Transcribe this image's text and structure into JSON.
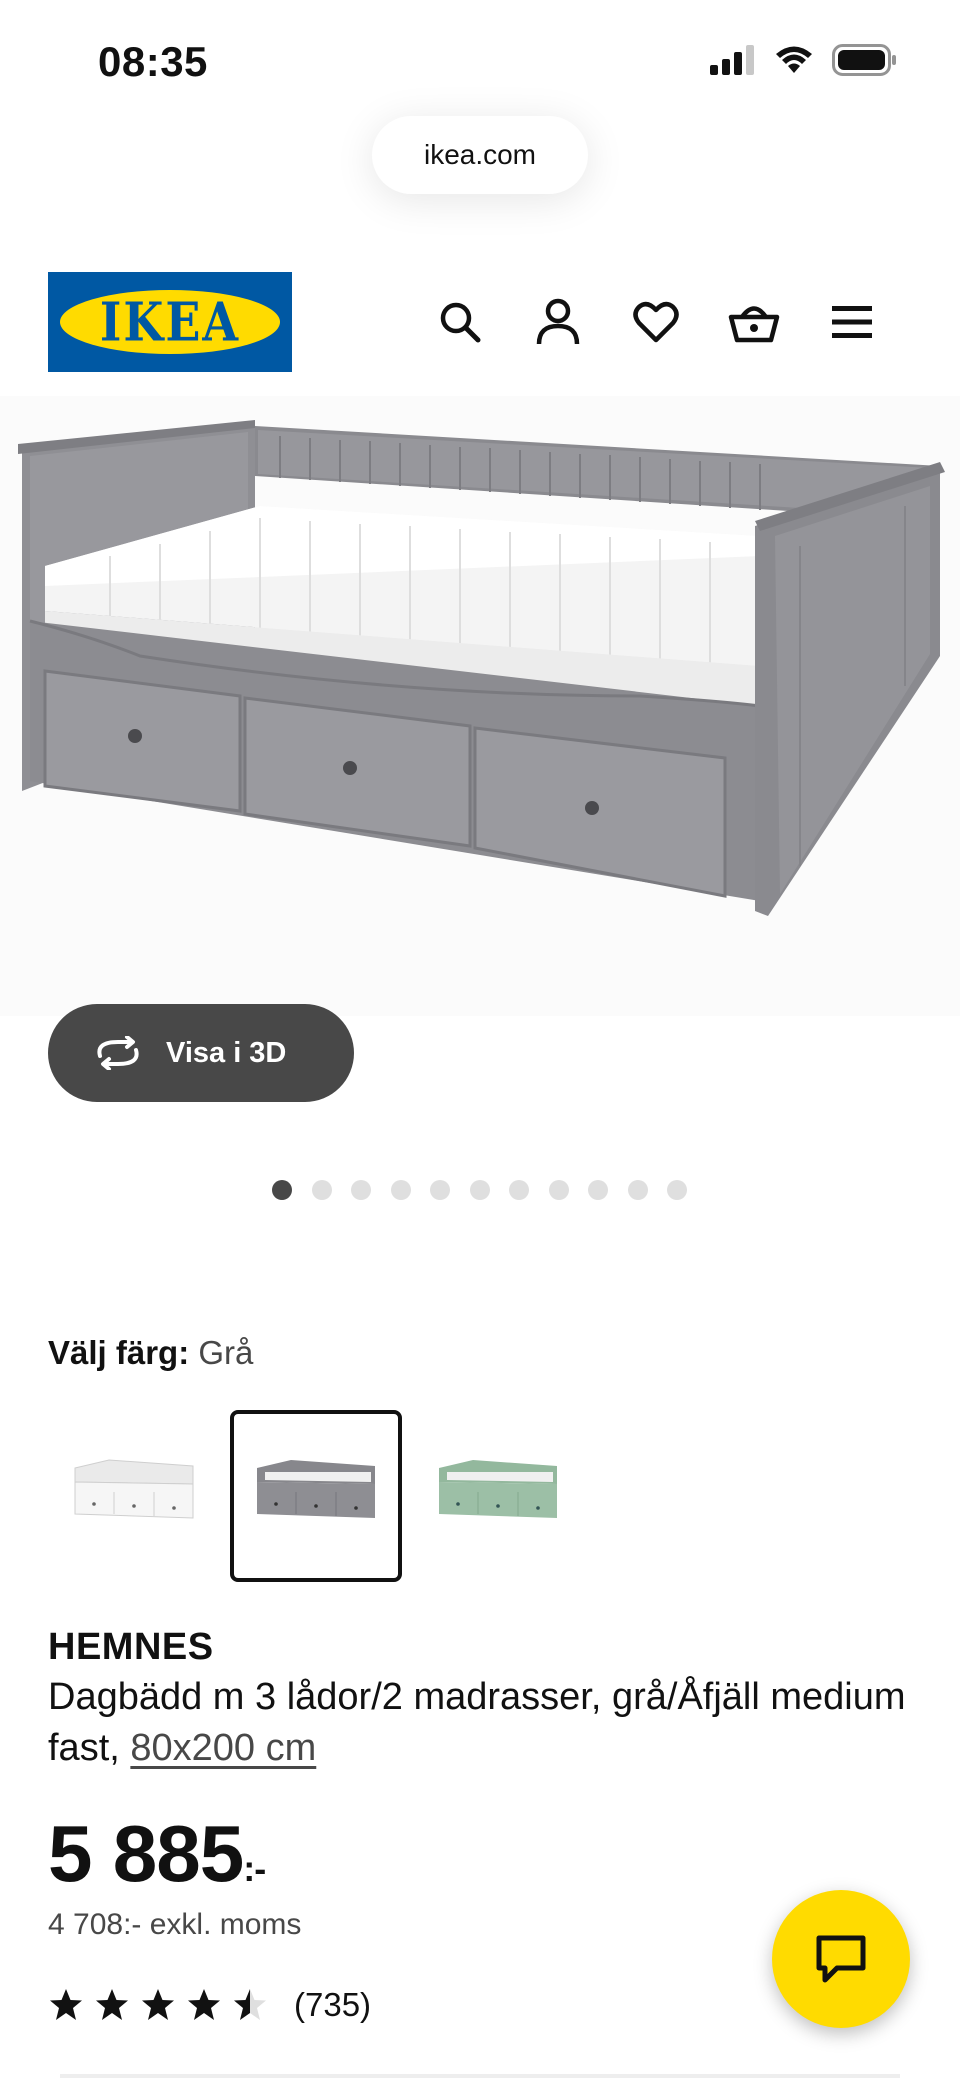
{
  "status_bar": {
    "time": "08:35"
  },
  "browser": {
    "url": "ikea.com"
  },
  "header": {
    "logo_text": "IKEA",
    "icons": [
      "search-icon",
      "account-icon",
      "heart-icon",
      "basket-icon",
      "menu-icon"
    ]
  },
  "gallery": {
    "view_3d_label": "Visa i 3D",
    "image_count": 11,
    "active_index": 0
  },
  "color_picker": {
    "label": "Välj färg:",
    "selected": "Grå",
    "options": [
      {
        "name": "white",
        "color": "#f2f2f2"
      },
      {
        "name": "grey",
        "color": "#8e8e93"
      },
      {
        "name": "green",
        "color": "#9cbfa6"
      }
    ],
    "selected_index": 1
  },
  "product": {
    "brand": "HEMNES",
    "description": "Dagbädd m 3 lådor/2 madrasser, grå/Åfjäll medium fast,",
    "size": "80x200 cm",
    "price": "5 885",
    "price_suffix": ":-",
    "price_ex_vat": "4 708:- exkl. moms",
    "rating_value": 4.5,
    "rating_max": 5,
    "rating_count": "(735)"
  },
  "colors": {
    "ikea_blue": "#0058a3",
    "ikea_yellow": "#ffdb00",
    "dark_button": "#484848"
  }
}
